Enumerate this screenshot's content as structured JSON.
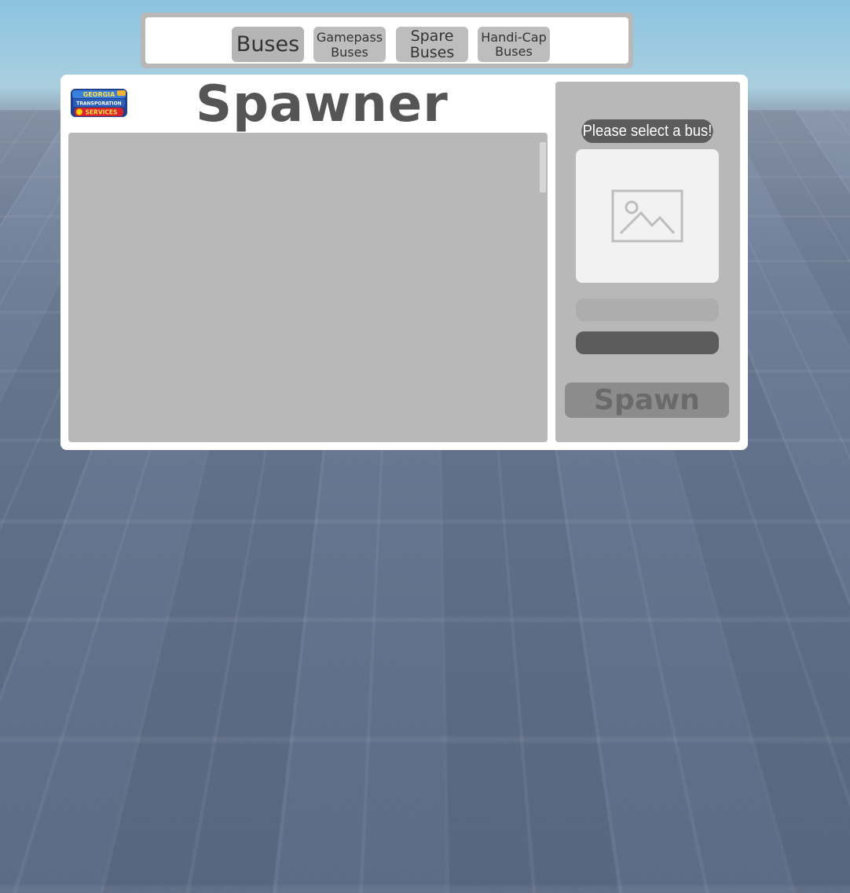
{
  "tabs": [
    {
      "label": "Buses"
    },
    {
      "label": "Gamepass Buses"
    },
    {
      "label": "Spare Buses"
    },
    {
      "label": "Handi-Cap Buses"
    }
  ],
  "spawner": {
    "title": "Spawner",
    "logo_text": "GEORGIA TRANSPORATION AND SERVICES"
  },
  "sidebar": {
    "select_label": "Please select a bus!",
    "preview_icon": "image-placeholder-icon",
    "spawn_label": "Spawn"
  },
  "colors": {
    "panel": "#ffffff",
    "gray_area": "#b8b8b8",
    "dark_label": "#5c5c5c",
    "title": "#555555",
    "spawn_button": "#8c8c8c"
  }
}
